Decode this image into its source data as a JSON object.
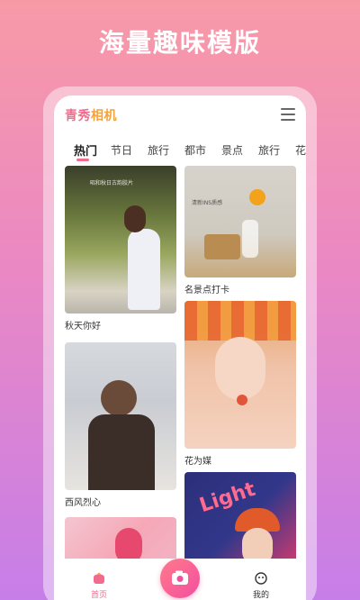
{
  "banner": {
    "title": "海量趣味模版"
  },
  "app": {
    "logo_part1": "青秀",
    "logo_part2": "相机"
  },
  "tabs": [
    {
      "label": "热门",
      "active": true
    },
    {
      "label": "节日"
    },
    {
      "label": "旅行"
    },
    {
      "label": "都市"
    },
    {
      "label": "景点"
    },
    {
      "label": "旅行"
    },
    {
      "label": "花"
    }
  ],
  "cards": [
    {
      "caption": "秋天你好",
      "overlay": "昭和秋日古韵胶片"
    },
    {
      "caption": "名景点打卡",
      "overlay": "清新INS质感"
    },
    {
      "caption": "西风烈心"
    },
    {
      "caption": "花为媒"
    },
    {
      "caption": ""
    },
    {
      "caption": "",
      "overlay": "Light"
    }
  ],
  "bottom_nav": {
    "home_label": "首页",
    "me_label": "我的"
  },
  "colors": {
    "accent": "#f06b8c",
    "logo_accent": "#f6a23a"
  }
}
